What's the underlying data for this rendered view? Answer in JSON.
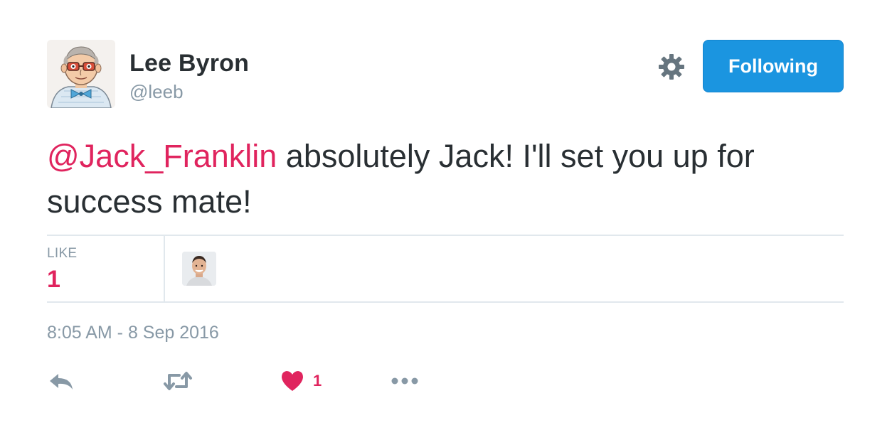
{
  "author": {
    "name": "Lee Byron",
    "handle": "@leeb"
  },
  "header": {
    "follow_button_label": "Following"
  },
  "tweet": {
    "mention": "@Jack_Franklin",
    "body": " absolutely Jack! I'll set you up for success mate!"
  },
  "stats": {
    "like_label": "LIKE",
    "like_count": "1"
  },
  "meta": {
    "timestamp": "8:05 AM - 8 Sep 2016"
  },
  "actions": {
    "like_count": "1"
  },
  "colors": {
    "accent": "#1b95e0",
    "like": "#e0245e",
    "muted": "#8899a6",
    "divider": "#e1e8ed"
  },
  "icons": [
    "gear-icon",
    "reply-icon",
    "retweet-icon",
    "heart-icon",
    "more-icon"
  ]
}
